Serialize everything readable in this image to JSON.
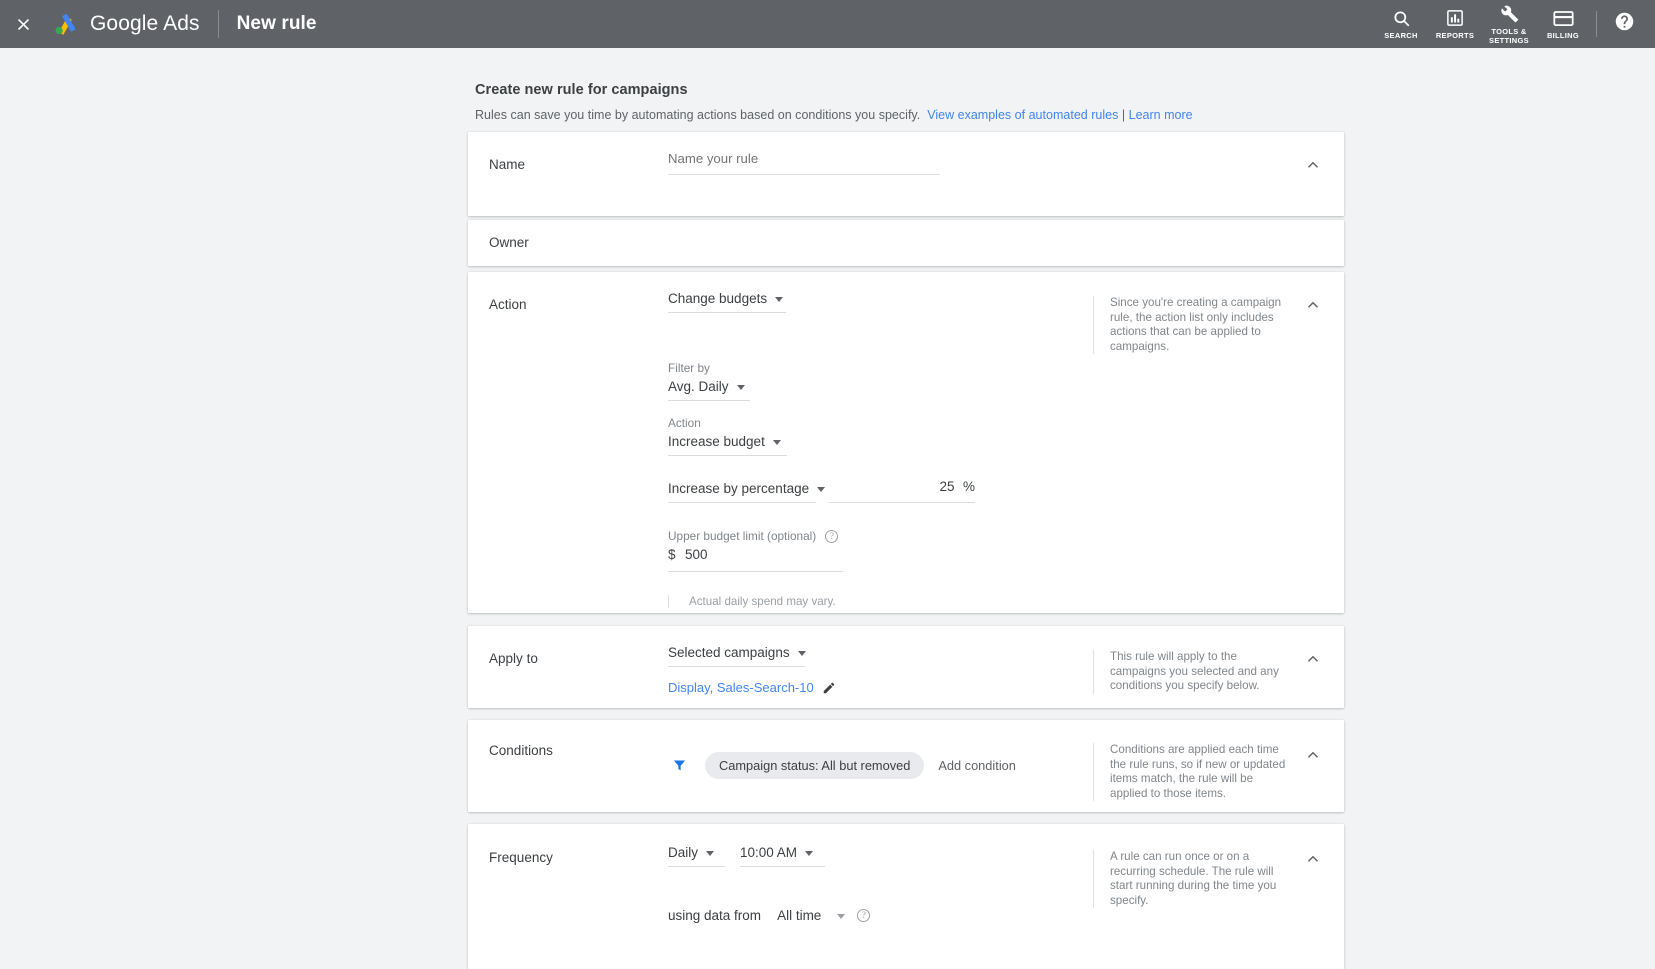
{
  "topbar": {
    "close_icon": "close-icon",
    "brand": "Google Ads",
    "page_title": "New rule",
    "items": [
      {
        "icon": "search-icon",
        "label": "SEARCH"
      },
      {
        "icon": "reports-icon",
        "label": "REPORTS"
      },
      {
        "icon": "tools-icon",
        "label": "TOOLS &\nSETTINGS"
      },
      {
        "icon": "billing-icon",
        "label": "BILLING"
      }
    ],
    "help_icon": "help-circle-icon"
  },
  "intro": {
    "heading": "Create new rule for campaigns",
    "description": "Rules can save you time by automating actions based on conditions you specify.",
    "link_examples": "View examples of automated rules",
    "separator": "|",
    "link_learn_more": "Learn more"
  },
  "cards": {
    "name": {
      "label": "Name",
      "input_placeholder": "Name your rule",
      "input_value": "",
      "collapse_icon": "chevron-up-icon"
    },
    "owner": {
      "label": "Owner"
    },
    "action": {
      "label": "Action",
      "action_type": "Change budgets",
      "side_note": "Since you're creating a campaign rule, the action list only includes actions that can be applied to campaigns.",
      "filter_by_label": "Filter by",
      "filter_by_value": "Avg. Daily",
      "action_label": "Action",
      "action_value": "Increase budget",
      "amount_type": "Increase by percentage",
      "amount_value": "25",
      "amount_unit": "%",
      "upper_limit_label": "Upper budget limit (optional)",
      "upper_limit_help": "help-icon",
      "upper_limit_currency": "$",
      "upper_limit_value": "500",
      "footnote": "Actual daily spend may vary.",
      "collapse_icon": "chevron-up-icon"
    },
    "apply_to": {
      "label": "Apply to",
      "scope": "Selected campaigns",
      "campaigns": "Display, Sales-Search-10",
      "edit_icon": "pencil-icon",
      "side_note": "This rule will apply to the campaigns you selected and any conditions you specify below.",
      "collapse_icon": "chevron-up-icon"
    },
    "conditions": {
      "label": "Conditions",
      "filter_icon": "filter-icon",
      "chip": "Campaign status: All but removed",
      "add_condition": "Add condition",
      "side_note": "Conditions are applied each time the rule runs, so if new or updated items match, the rule will be applied to those items.",
      "collapse_icon": "chevron-up-icon"
    },
    "frequency": {
      "label": "Frequency",
      "interval": "Daily",
      "time": "10:00 AM",
      "using_data_from_label": "using data from",
      "using_data_from_value": "All time",
      "using_data_help": "help-icon",
      "side_note": "A rule can run once or on a recurring schedule. The rule will start running during the time you specify.",
      "collapse_icon": "chevron-up-icon"
    }
  },
  "colors": {
    "topbar_bg": "#5f6368",
    "page_bg": "#f1f3f4",
    "link": "#4285f4",
    "text_primary": "#3c4043",
    "text_secondary": "#5f6368",
    "text_muted": "#80868b",
    "chip_bg": "#e8eaed"
  }
}
